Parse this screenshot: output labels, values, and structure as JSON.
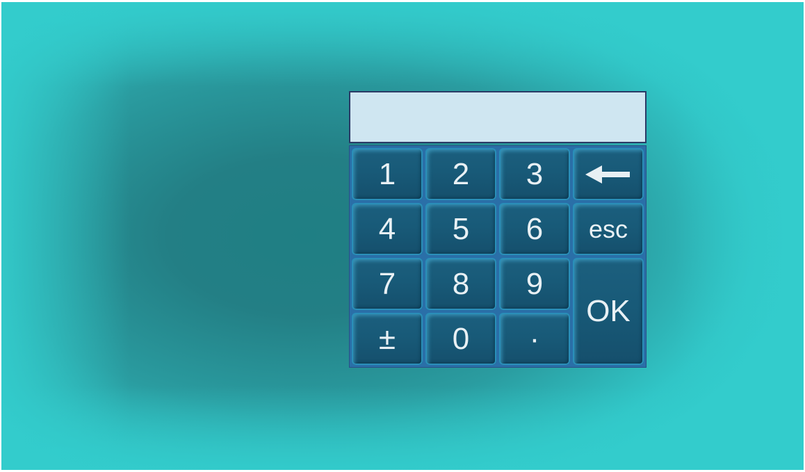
{
  "keypad": {
    "display_value": "",
    "keys": {
      "k1": "1",
      "k2": "2",
      "k3": "3",
      "k4": "4",
      "k5": "5",
      "k6": "6",
      "k7": "7",
      "k8": "8",
      "k9": "9",
      "k0": "0",
      "plus_minus": "±",
      "decimal": "·",
      "esc": "esc",
      "ok": "OK"
    },
    "backspace_icon": "left-arrow-icon"
  },
  "colors": {
    "background": "#33cccc",
    "background_center": "#1f7f84",
    "display_bg": "#cfe6f1",
    "key_bg": "#185a78",
    "key_border": "#2a8fb9",
    "key_text": "#e8f0f4"
  }
}
